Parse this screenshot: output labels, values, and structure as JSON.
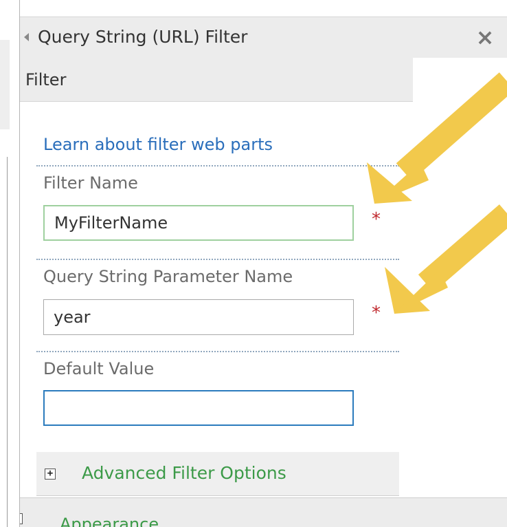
{
  "pane": {
    "title": "Query String (URL) Filter",
    "close_glyph": "×",
    "section_label": "Filter"
  },
  "learn_link": "Learn about filter web parts",
  "fields": {
    "filter_name": {
      "label": "Filter Name",
      "value": "MyFilterName",
      "required_mark": "*"
    },
    "query_param": {
      "label": "Query String Parameter Name",
      "value": "year",
      "required_mark": "*"
    },
    "default_value": {
      "label": "Default Value",
      "value": ""
    }
  },
  "advanced": {
    "expand_glyph": "+",
    "label": "Advanced Filter Options"
  },
  "appearance": {
    "expand_glyph": "−",
    "label": "Appearance"
  },
  "colors": {
    "link": "#2a6ebb",
    "section_label": "#3c9a48",
    "required_mark": "#c0282d",
    "annotation_arrow": "#f2c94c",
    "focus_border": "#2b7bbd",
    "valid_border": "#9ed09e"
  }
}
